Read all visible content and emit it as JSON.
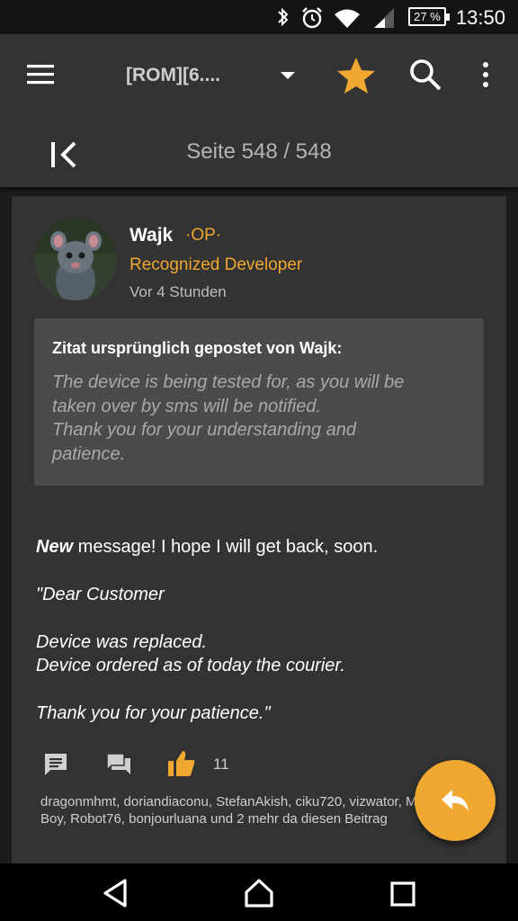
{
  "status_bar": {
    "time": "13:50",
    "battery": "27 %",
    "icons": [
      "bluetooth-icon",
      "alarm-icon",
      "wifi-icon",
      "signal-icon",
      "battery-icon"
    ]
  },
  "app_bar": {
    "title": "[ROM][6....",
    "icons": [
      "menu-icon",
      "dropdown-icon",
      "star-icon",
      "search-icon",
      "more-icon"
    ]
  },
  "page_nav": {
    "text": "Seite 548 / 548"
  },
  "post": {
    "username": "Wajk",
    "op_badge": "·OP·",
    "role": "Recognized Developer",
    "time_ago": "Vor 4 Stunden",
    "quote": {
      "header": "Zitat ursprünglich gepostet von Wajk:",
      "lines": [
        "The device is being tested for, as you will be",
        "taken over by sms will be notified.",
        "Thank you for your understanding and",
        "patience."
      ]
    },
    "message": {
      "line1_bold": "New",
      "line1_rest": " message! I hope I will get back, soon.",
      "line2": "\"Dear Customer",
      "line3": "Device was replaced.",
      "line4": "Device ordered as of today the courier.",
      "line5": "Thank you for your patience.\""
    },
    "likes_count": "11",
    "likers_text": "dragonmhmt, doriandiaconu, StefanAkish, ciku720, vizwator, Metall Boy, Robot76, bonjourluana und 2 mehr da diesen Beitrag"
  },
  "colors": {
    "accent": "#f0a830",
    "background": "#1c1c1c",
    "card": "#333333",
    "quote_bg": "#4b4b4b"
  }
}
